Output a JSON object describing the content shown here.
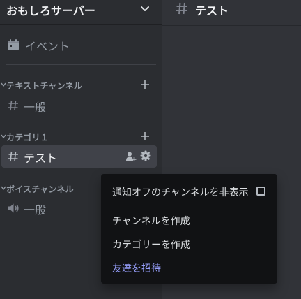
{
  "server": {
    "name": "おもしろサーバー"
  },
  "events": {
    "label": "イベント"
  },
  "categories": [
    {
      "label": "テキストチャンネル"
    },
    {
      "label": "カテゴリ１"
    },
    {
      "label": "ボイスチャンネル"
    }
  ],
  "channels": [
    {
      "label": "一般",
      "type": "text"
    },
    {
      "label": "テスト",
      "type": "text",
      "selected": true
    },
    {
      "label": "一般",
      "type": "voice"
    }
  ],
  "main": {
    "title": "テスト"
  },
  "context_menu": {
    "items": [
      {
        "label": "通知オフのチャンネルを非表示",
        "checked": false
      },
      {
        "label": "チャンネルを作成"
      },
      {
        "label": "カテゴリーを作成"
      },
      {
        "label": "友達を招待",
        "brand": true
      }
    ]
  },
  "colors": {
    "sidebar_bg": "#2b2d31",
    "main_bg": "#313338",
    "menu_bg": "#111214",
    "selected_bg": "#404249",
    "brand_text": "#949cf7",
    "muted_text": "#949ba4"
  }
}
